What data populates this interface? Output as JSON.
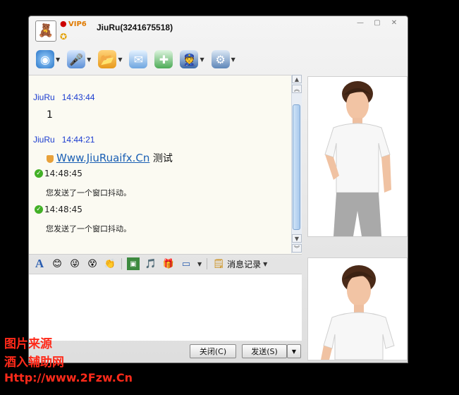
{
  "window": {
    "title": "JiuRu(3241675518)",
    "vip_badge": "VIP6",
    "controls": [
      "minimize-icon",
      "maximize-icon",
      "close-icon"
    ]
  },
  "toolbar_top": {
    "buttons": [
      {
        "name": "video-call-icon",
        "has_menu": true
      },
      {
        "name": "voice-call-icon",
        "has_menu": true
      },
      {
        "name": "send-file-icon",
        "has_menu": true
      },
      {
        "name": "send-sms-icon",
        "has_menu": false
      },
      {
        "name": "create-group-icon",
        "has_menu": false
      },
      {
        "name": "app-icon",
        "has_menu": true
      },
      {
        "name": "settings-icon",
        "has_menu": true
      }
    ]
  },
  "chat": {
    "messages": [
      {
        "sender": "JiuRu",
        "time": "14:43:44",
        "text": "1"
      },
      {
        "sender": "JiuRu",
        "time": "14:44:21",
        "link": "Www.JiuRuaifx.Cn",
        "text": "测试"
      }
    ],
    "system": [
      {
        "time": "14:48:45",
        "text": "您发送了一个窗口抖动。"
      },
      {
        "time": "14:48:45",
        "text": "您发送了一个窗口抖动。"
      }
    ]
  },
  "toolbar_input": {
    "history_label": "消息记录"
  },
  "buttons": {
    "close": "关闭(C)",
    "send": "发送(S)"
  },
  "watermark": {
    "line1": "图片来源",
    "line2": "酒入辅助网",
    "line3": "Http://www.2Fzw.Cn"
  },
  "colors": {
    "sender": "#1b3ccf",
    "link": "#1a5fb4",
    "watermark": "#ff2a1a"
  }
}
